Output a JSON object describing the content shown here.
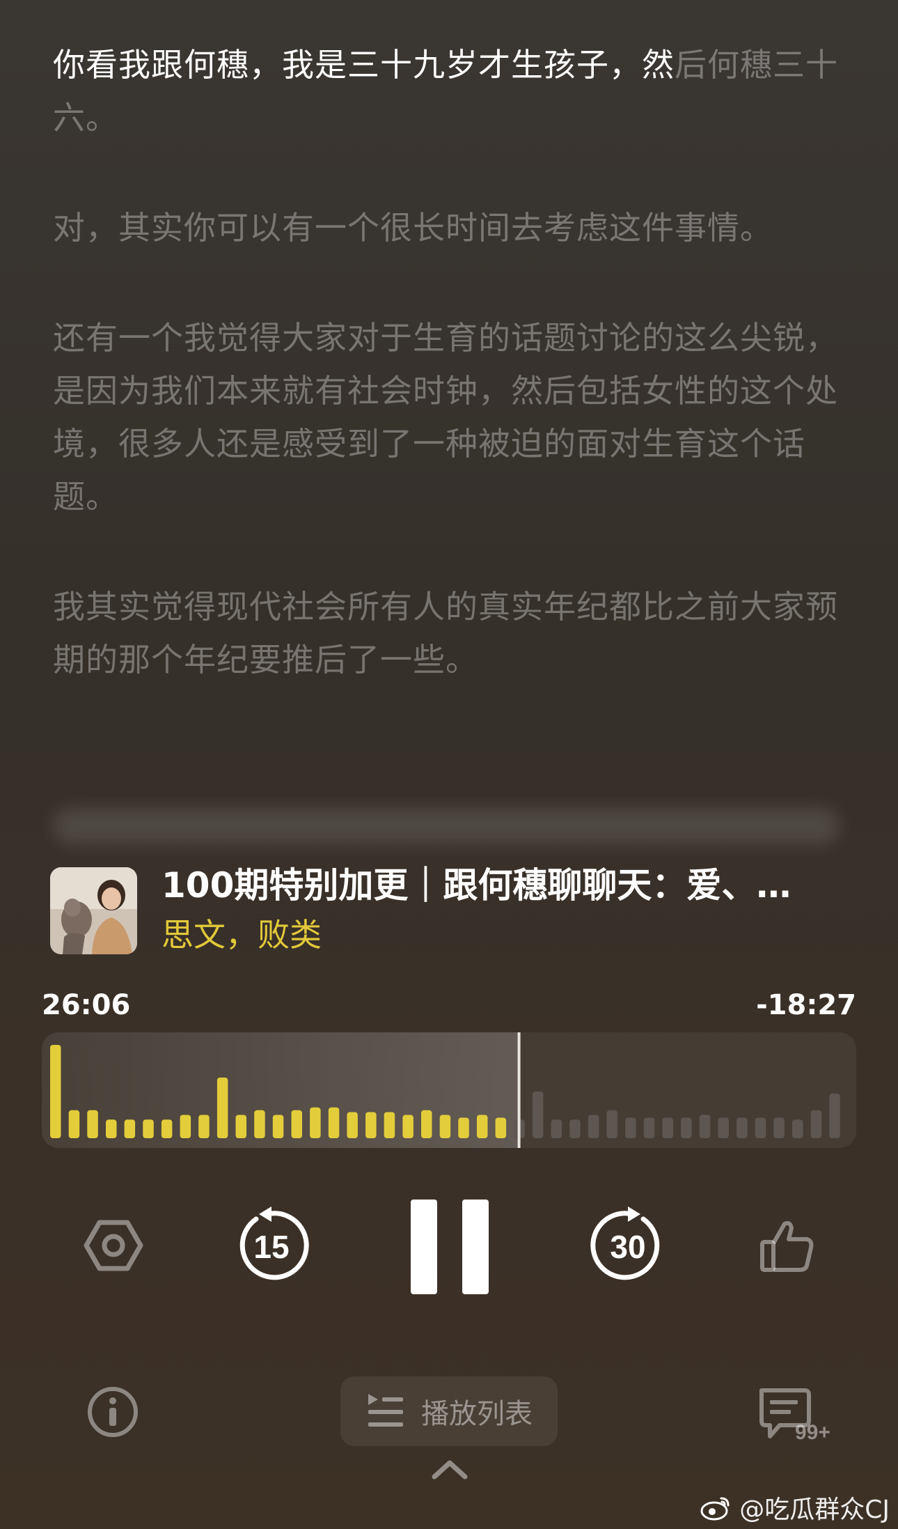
{
  "transcript": {
    "paragraphs": [
      {
        "highlighted": "你看我跟何穗，我是三十九岁才生孩子，然",
        "rest": "后何穗三十六。"
      },
      {
        "highlighted": "",
        "rest": "对，其实你可以有一个很长时间去考虑这件事情。"
      },
      {
        "highlighted": "",
        "rest": "还有一个我觉得大家对于生育的话题讨论的这么尖锐，是因为我们本来就有社会时钟，然后包括女性的这个处境，很多人还是感受到了一种被迫的面对生育这个话题。"
      },
      {
        "highlighted": "",
        "rest": "我其实觉得现代社会所有人的真实年纪都比之前大家预期的那个年纪要推后了一些。"
      }
    ]
  },
  "episode": {
    "title": "100期特别加更｜跟何穗聊聊天：爱、…",
    "author": "思文，败类"
  },
  "playback": {
    "elapsed": "26:06",
    "remaining": "-18:27",
    "progress": 0.586
  },
  "waveform": {
    "bars": [
      1.0,
      0.3,
      0.3,
      0.2,
      0.2,
      0.2,
      0.2,
      0.25,
      0.25,
      0.65,
      0.25,
      0.3,
      0.25,
      0.3,
      0.33,
      0.33,
      0.28,
      0.28,
      0.28,
      0.25,
      0.3,
      0.25,
      0.22,
      0.25,
      0.22,
      0.2,
      0.5,
      0.2,
      0.2,
      0.25,
      0.3,
      0.22,
      0.22,
      0.22,
      0.22,
      0.25,
      0.22,
      0.22,
      0.22,
      0.22,
      0.2,
      0.3,
      0.48
    ],
    "played_color": "#e3cd3a",
    "unplayed_color": "#5e5650"
  },
  "controls": {
    "speed_icon": "hexagon-speed-icon",
    "rewind_seconds": "15",
    "forward_seconds": "30",
    "like_icon": "thumbs-up-icon",
    "info_icon": "info-icon",
    "playlist_label": "播放列表",
    "comments_badge": "99+"
  },
  "watermark": {
    "text": "@吃瓜群众CJ"
  },
  "colors": {
    "accent": "#e2c93a",
    "background": "#36302a"
  }
}
